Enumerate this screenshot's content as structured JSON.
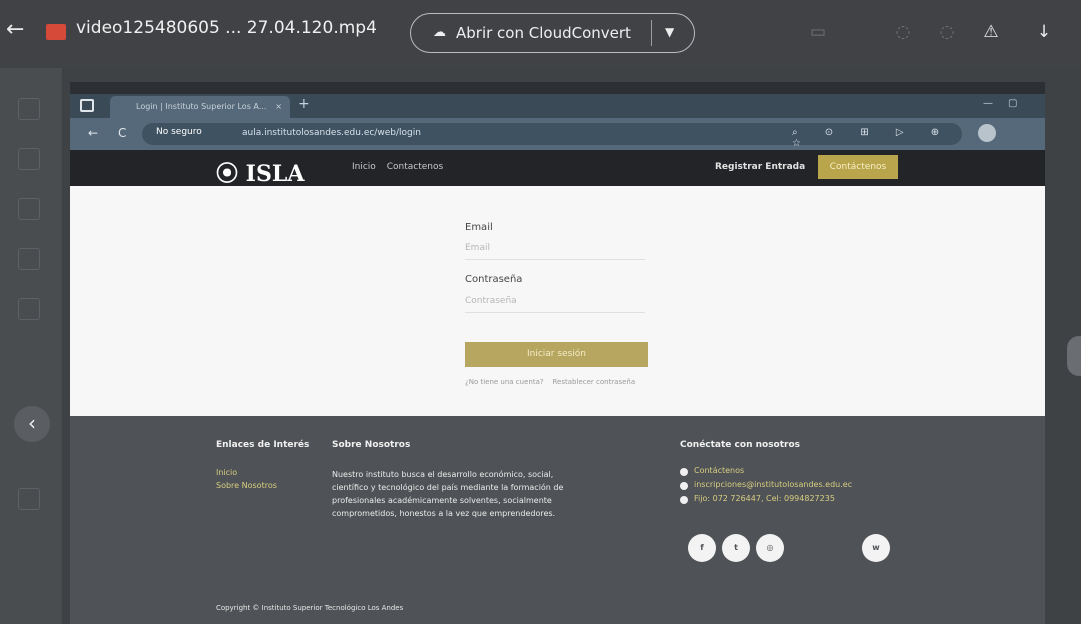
{
  "viewer": {
    "file_name": "video125480605 ... 27.04.120.mp4",
    "open_with_label": "Abrir con CloudConvert",
    "icons": [
      "back-icon",
      "file-icon",
      "cloud-icon",
      "chevron-down-icon",
      "comment-icon",
      "info-icon",
      "add-to-drive-icon",
      "download-icon",
      "previous-icon"
    ]
  },
  "browser": {
    "tab_title": "Login | Instituto Superior Los A...",
    "not_secure_label": "No seguro",
    "url": "aula.institutolosandes.edu.ec/web/login"
  },
  "site": {
    "logo": "ISLA",
    "nav": [
      "Inicio",
      "Contactenos"
    ],
    "right_link": "Registrar Entrada",
    "cta": "Contáctenos"
  },
  "login": {
    "email_label": "Email",
    "email_placeholder": "Email",
    "password_label": "Contraseña",
    "password_placeholder": "Contraseña",
    "button": "Iniciar sesión",
    "no_account": "¿No tiene una cuenta?",
    "reset_password": "Restablecer contraseña"
  },
  "footer": {
    "links_title": "Enlaces de Interés",
    "links": [
      "Inicio",
      "Sobre Nosotros"
    ],
    "about_title": "Sobre Nosotros",
    "about_text": "Nuestro instituto busca el desarrollo económico, social, científico y tecnológico del país mediante la formación de profesionales académicamente solventes, socialmente comprometidos, honestos a la vez que emprendedores.",
    "contact_title": "Conéctate con nosotros",
    "contact_items": [
      "Contáctenos",
      "inscripciones@institutolosandes.edu.ec",
      "Fijo: 072 726447, Cel: 0994827235"
    ],
    "copyright": "Copyright © Instituto Superior Tecnológico Los Andes"
  }
}
